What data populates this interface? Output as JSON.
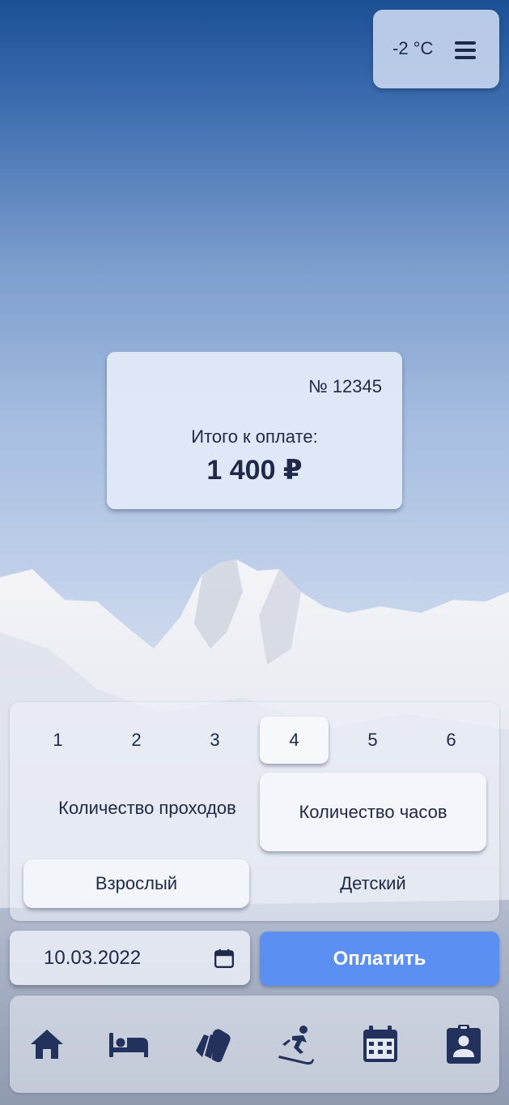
{
  "weather": {
    "temperature": "-2 °C",
    "menu_icon": "hamburger-menu-icon"
  },
  "order": {
    "number": "№ 12345",
    "total_label": "Итого к оплате:",
    "total_amount": "1 400 ₽"
  },
  "hours": {
    "options": [
      "1",
      "2",
      "3",
      "4",
      "5",
      "6"
    ],
    "selected": "4"
  },
  "mode": {
    "passes_label": "Количество проходов",
    "hours_label": "Количество часов",
    "selected": "hours"
  },
  "age": {
    "adult_label": "Взрослый",
    "child_label": "Детский",
    "selected": "adult"
  },
  "date": {
    "value": "10.03.2022",
    "icon": "calendar-icon"
  },
  "pay_button": {
    "label": "Оплатить",
    "color": "#5b8ff2"
  },
  "bottom_nav": {
    "items": [
      {
        "id": "home",
        "icon": "home-icon"
      },
      {
        "id": "hotel",
        "icon": "bed-icon"
      },
      {
        "id": "tickets",
        "icon": "cards-icon"
      },
      {
        "id": "ski",
        "icon": "skier-icon"
      },
      {
        "id": "calendar",
        "icon": "calendar-icon"
      },
      {
        "id": "profile",
        "icon": "badge-icon"
      }
    ]
  },
  "colors": {
    "accent": "#5b8ff2",
    "text": "#202a48",
    "icon": "#23325c"
  }
}
